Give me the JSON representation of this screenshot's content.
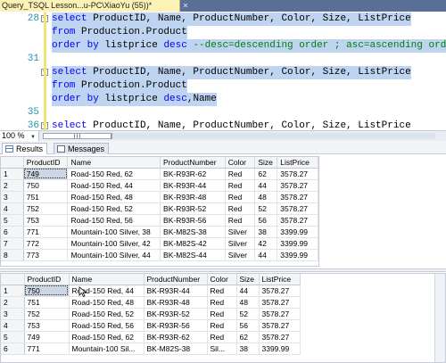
{
  "window": {
    "tab_title": "Query_TSQL Lesson...u-PC\\XiaoYu (55))*",
    "tab_close": "✕"
  },
  "editor": {
    "lines": [
      {
        "num": "28",
        "selected": true,
        "tokens": [
          [
            "kw",
            "select"
          ],
          [
            "tx",
            " ProductID, Name, ProductNumber, Color, Size, ListPrice"
          ]
        ]
      },
      {
        "num": "",
        "selected": true,
        "tokens": [
          [
            "kw",
            "from"
          ],
          [
            "tx",
            " Production.Product"
          ]
        ]
      },
      {
        "num": "",
        "selected": true,
        "tokens": [
          [
            "kw",
            "order by"
          ],
          [
            "tx",
            " listprice "
          ],
          [
            "kw",
            "desc"
          ],
          [
            "cm",
            " --desc=descending order ; asc=ascending order"
          ]
        ]
      },
      {
        "num": "31",
        "selected": false,
        "tokens": []
      },
      {
        "num": "",
        "selected": true,
        "tokens": [
          [
            "kw",
            "select"
          ],
          [
            "tx",
            " ProductID, Name, ProductNumber, Color, Size, ListPrice"
          ]
        ]
      },
      {
        "num": "",
        "selected": true,
        "tokens": [
          [
            "kw",
            "from"
          ],
          [
            "tx",
            " Production.Product"
          ]
        ]
      },
      {
        "num": "",
        "selected": true,
        "tokens": [
          [
            "kw",
            "order by"
          ],
          [
            "tx",
            " listprice "
          ],
          [
            "kw",
            "desc"
          ],
          [
            "tx",
            ",Name"
          ]
        ]
      },
      {
        "num": "35",
        "selected": false,
        "tokens": []
      },
      {
        "num": "36",
        "selected": false,
        "tokens": [
          [
            "kw",
            "select"
          ],
          [
            "tx",
            " ProductID, Name, ProductNumber, Color, Size, ListPrice"
          ]
        ]
      },
      {
        "num": "",
        "selected": false,
        "tokens": [
          [
            "kw",
            "from"
          ],
          [
            "tx",
            " Production.Product"
          ]
        ]
      }
    ]
  },
  "zoom": {
    "value": "100 %"
  },
  "result_tabs": [
    {
      "label": "Results",
      "active": true
    },
    {
      "label": "Messages",
      "active": false
    }
  ],
  "columns": [
    "",
    "ProductID",
    "Name",
    "ProductNumber",
    "Color",
    "Size",
    "ListPrice"
  ],
  "grid1": {
    "rows": [
      [
        "1",
        "749",
        "Road-150 Red, 62",
        "BK-R93R-62",
        "Red",
        "62",
        "3578.27"
      ],
      [
        "2",
        "750",
        "Road-150 Red, 44",
        "BK-R93R-44",
        "Red",
        "44",
        "3578.27"
      ],
      [
        "3",
        "751",
        "Road-150 Red, 48",
        "BK-R93R-48",
        "Red",
        "48",
        "3578.27"
      ],
      [
        "4",
        "752",
        "Road-150 Red, 52",
        "BK-R93R-52",
        "Red",
        "52",
        "3578.27"
      ],
      [
        "5",
        "753",
        "Road-150 Red, 56",
        "BK-R93R-56",
        "Red",
        "56",
        "3578.27"
      ],
      [
        "6",
        "771",
        "Mountain-100 Silver, 38",
        "BK-M82S-38",
        "Silver",
        "38",
        "3399.99"
      ],
      [
        "7",
        "772",
        "Mountain-100 Silver, 42",
        "BK-M82S-42",
        "Silver",
        "42",
        "3399.99"
      ],
      [
        "8",
        "773",
        "Mountain-100 Silver, 44",
        "BK-M82S-44",
        "Silver",
        "44",
        "3399.99"
      ]
    ]
  },
  "grid2": {
    "rows": [
      [
        "1",
        "750",
        "Road-150 Red, 44",
        "BK-R93R-44",
        "Red",
        "44",
        "3578.27"
      ],
      [
        "2",
        "751",
        "Road-150 Red, 48",
        "BK-R93R-48",
        "Red",
        "48",
        "3578.27"
      ],
      [
        "3",
        "752",
        "Road-150 Red, 52",
        "BK-R93R-52",
        "Red",
        "52",
        "3578.27"
      ],
      [
        "4",
        "753",
        "Road-150 Red, 56",
        "BK-R93R-56",
        "Red",
        "56",
        "3578.27"
      ],
      [
        "5",
        "749",
        "Road-150 Red, 62",
        "BK-R93R-62",
        "Red",
        "62",
        "3578.27"
      ],
      [
        "6",
        "771",
        "Mountain-100 Sil...",
        "BK-M82S-38",
        "Sil...",
        "38",
        "3399.99"
      ]
    ]
  },
  "colors": {
    "selection": "#bfd4f0",
    "keyword": "#0000ff",
    "comment": "#008000",
    "line_number": "#2b91af",
    "tab_active": "#fdf2b6",
    "tabstrip": "#5a6f95"
  }
}
